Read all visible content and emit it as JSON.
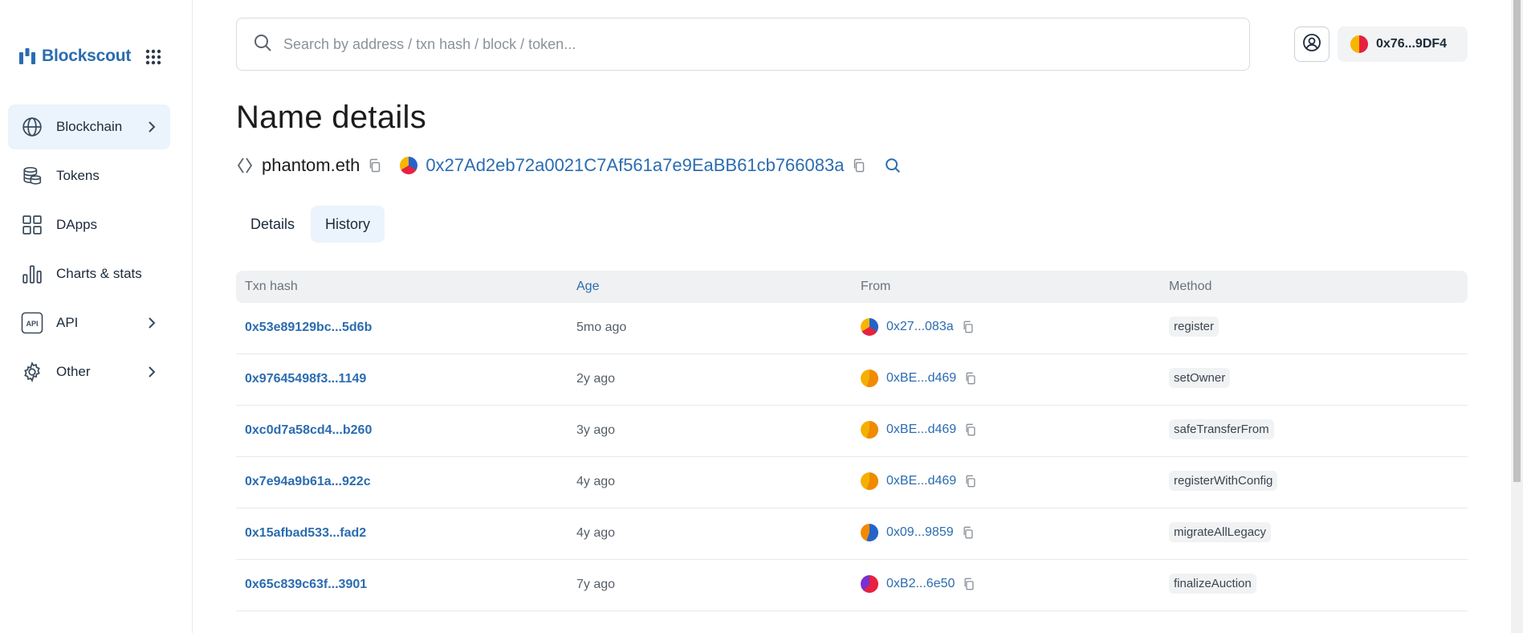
{
  "brand": {
    "name": "Blockscout"
  },
  "sidebar": {
    "items": [
      {
        "label": "Blockchain",
        "icon": "globe-icon",
        "active": true,
        "has_chevron": true
      },
      {
        "label": "Tokens",
        "icon": "coins-icon",
        "active": false,
        "has_chevron": false
      },
      {
        "label": "DApps",
        "icon": "grid-icon",
        "active": false,
        "has_chevron": false
      },
      {
        "label": "Charts & stats",
        "icon": "chart-icon",
        "active": false,
        "has_chevron": false
      },
      {
        "label": "API",
        "icon": "api-icon",
        "active": false,
        "has_chevron": true
      },
      {
        "label": "Other",
        "icon": "gear-icon",
        "active": false,
        "has_chevron": true
      }
    ]
  },
  "search": {
    "placeholder": "Search by address / txn hash / block / token..."
  },
  "wallet": {
    "address": "0x76...9DF4"
  },
  "page": {
    "title": "Name details",
    "ens_name": "phantom.eth",
    "resolved_address": "0x27Ad2eb72a0021C7Af561a7e9EaBB61cb766083a"
  },
  "tabs": [
    {
      "label": "Details",
      "active": false
    },
    {
      "label": "History",
      "active": true
    }
  ],
  "table": {
    "headers": {
      "txn_hash": "Txn hash",
      "age": "Age",
      "from": "From",
      "method": "Method"
    },
    "rows": [
      {
        "txn_hash": "0x53e89129bc...5d6b",
        "age": "5mo ago",
        "from": "0x27...083a",
        "method": "register",
        "avatar": "multi"
      },
      {
        "txn_hash": "0x97645498f3...1149",
        "age": "2y ago",
        "from": "0xBE...d469",
        "method": "setOwner",
        "avatar": "orange"
      },
      {
        "txn_hash": "0xc0d7a58cd4...b260",
        "age": "3y ago",
        "from": "0xBE...d469",
        "method": "safeTransferFrom",
        "avatar": "orange"
      },
      {
        "txn_hash": "0x7e94a9b61a...922c",
        "age": "4y ago",
        "from": "0xBE...d469",
        "method": "registerWithConfig",
        "avatar": "orange"
      },
      {
        "txn_hash": "0x15afbad533...fad2",
        "age": "4y ago",
        "from": "0x09...9859",
        "method": "migrateAllLegacy",
        "avatar": "blue"
      },
      {
        "txn_hash": "0x65c839c63f...3901",
        "age": "7y ago",
        "from": "0xB2...6e50",
        "method": "finalizeAuction",
        "avatar": "pink"
      }
    ]
  },
  "colors": {
    "accent": "#2b6cb0",
    "active_bg": "#ebf4fc"
  }
}
